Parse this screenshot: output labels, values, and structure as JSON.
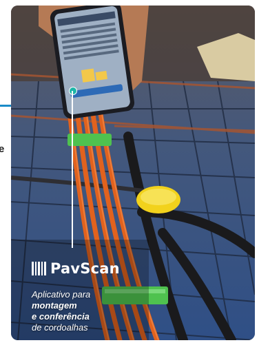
{
  "page": {
    "edge_text": "e"
  },
  "brand": {
    "name": "PavScan",
    "icon": "barcode-icon"
  },
  "tagline": {
    "line1": "Aplicativo para",
    "line2": "montagem",
    "line3": "e conferência",
    "line4": "de cordoalhas"
  },
  "colors": {
    "accent": "#1a8bc8",
    "cable_orange": "#e1621e",
    "clip_green": "#4fc24f",
    "cap_yellow": "#f2d21c"
  }
}
